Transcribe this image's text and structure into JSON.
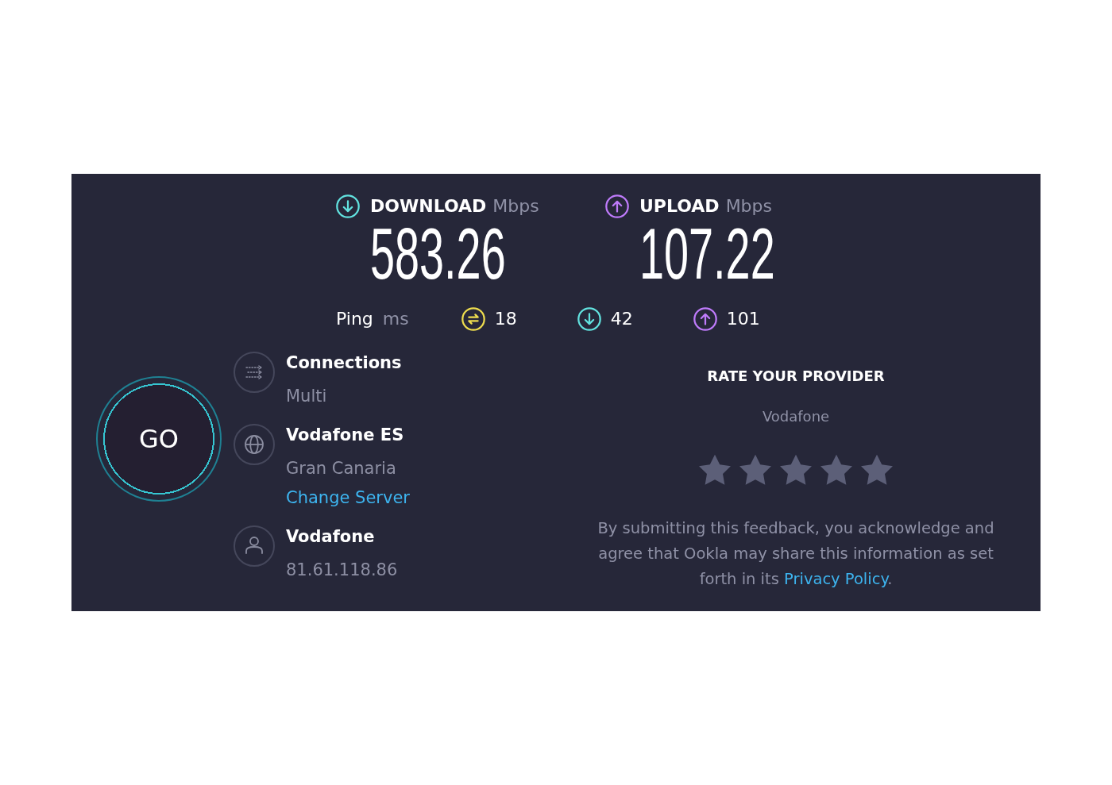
{
  "speeds": [
    {
      "kind": "download",
      "label": "DOWNLOAD",
      "unit": "Mbps",
      "value": "583.26"
    },
    {
      "kind": "upload",
      "label": "UPLOAD",
      "unit": "Mbps",
      "value": "107.22"
    }
  ],
  "ping": {
    "label": "Ping",
    "unit": "ms",
    "items": [
      {
        "kind": "idle",
        "value": "18"
      },
      {
        "kind": "download",
        "value": "42"
      },
      {
        "kind": "upload",
        "value": "101"
      }
    ]
  },
  "go_button": {
    "label": "GO"
  },
  "details": [
    {
      "kind": "connections",
      "title": "Connections",
      "subtitle": "Multi"
    },
    {
      "kind": "server",
      "title": "Vodafone ES",
      "subtitle": "Gran Canaria",
      "link": "Change Server"
    },
    {
      "kind": "provider",
      "title": "Vodafone",
      "subtitle": "81.61.118.86"
    }
  ],
  "rating": {
    "title": "RATE YOUR PROVIDER",
    "provider": "Vodafone",
    "disclaimer": "By submitting this feedback, you acknowledge and agree that Ookla may share this information as set forth in its",
    "link": "Privacy Policy",
    "disclaimer_end": "."
  }
}
